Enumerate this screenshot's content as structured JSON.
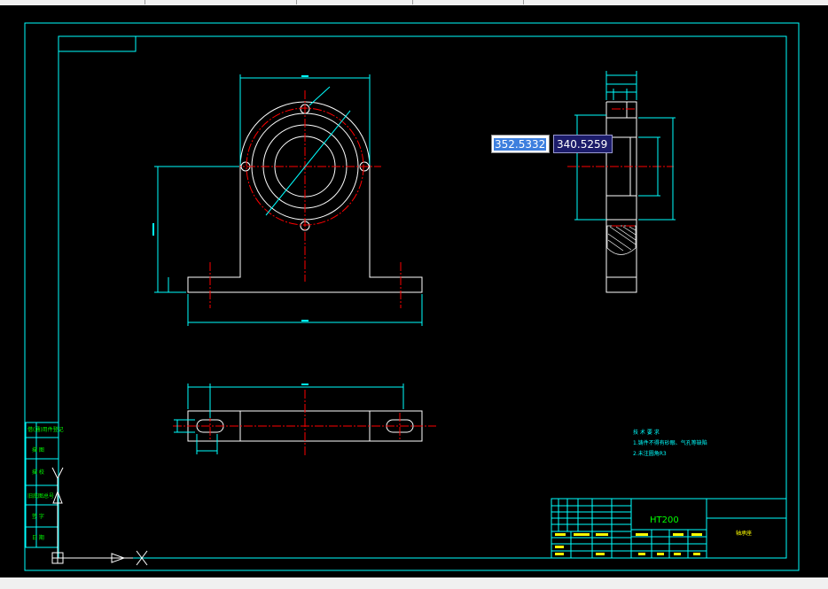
{
  "app": {
    "tabs": [
      "",
      "",
      "",
      ""
    ]
  },
  "cursor_input": {
    "x_value": "352.5332",
    "y_value": "340.5259"
  },
  "title_block": {
    "material": "HT200",
    "part_name": "轴承座"
  },
  "tech_requirements": {
    "heading": "技 术 要 求",
    "line1": "1.铸件不得有砂眼、气孔等缺陷",
    "line2": "2.未注圆角R3"
  },
  "side_table": {
    "rows": [
      "借(通)用件登记",
      "描 图",
      "描 校",
      "旧底图总号",
      "签 字",
      "日 期"
    ]
  },
  "colors": {
    "background": "#000000",
    "frame": "#00ffff",
    "outline": "#ffffff",
    "centerline": "#ff0000",
    "title_text": "#00ff00"
  }
}
